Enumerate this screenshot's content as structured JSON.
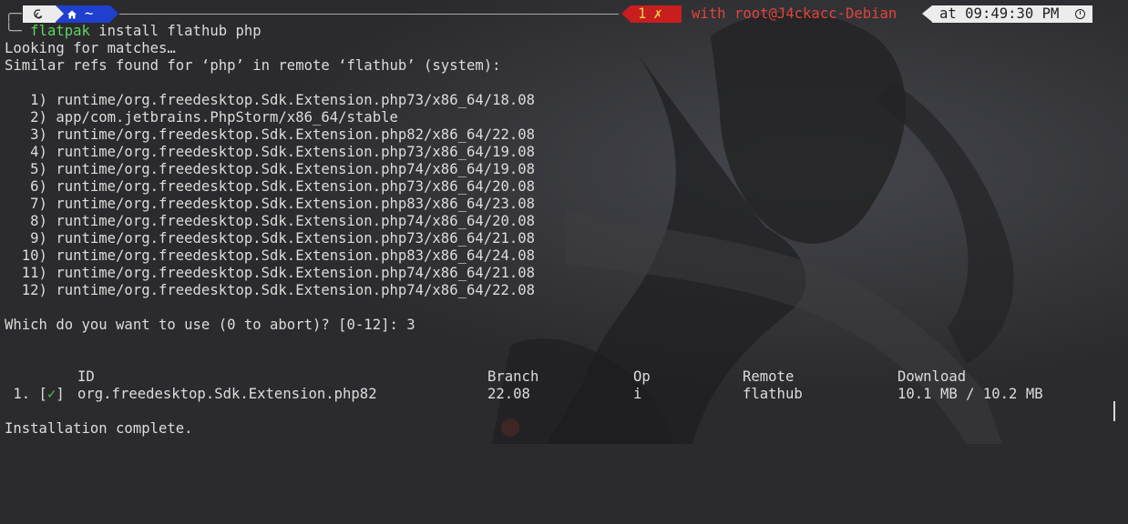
{
  "prompt": {
    "dir_icon": "home-icon",
    "dir_label": "~",
    "os_icon": "debian-swirl-icon",
    "error_count": "1",
    "error_mark": "✗",
    "user_host": "with root@J4ckacc-Debian",
    "time": "at 09:49:30 PM",
    "command_name": "flatpak",
    "command_args": " install flathub php"
  },
  "output": {
    "looking": "Looking for matches…",
    "similar": "Similar refs found for ‘php’ in remote ‘flathub’ (system):",
    "refs": [
      "   1) runtime/org.freedesktop.Sdk.Extension.php73/x86_64/18.08",
      "   2) app/com.jetbrains.PhpStorm/x86_64/stable",
      "   3) runtime/org.freedesktop.Sdk.Extension.php82/x86_64/22.08",
      "   4) runtime/org.freedesktop.Sdk.Extension.php73/x86_64/19.08",
      "   5) runtime/org.freedesktop.Sdk.Extension.php74/x86_64/19.08",
      "   6) runtime/org.freedesktop.Sdk.Extension.php73/x86_64/20.08",
      "   7) runtime/org.freedesktop.Sdk.Extension.php83/x86_64/23.08",
      "   8) runtime/org.freedesktop.Sdk.Extension.php74/x86_64/20.08",
      "   9) runtime/org.freedesktop.Sdk.Extension.php73/x86_64/21.08",
      "  10) runtime/org.freedesktop.Sdk.Extension.php83/x86_64/24.08",
      "  11) runtime/org.freedesktop.Sdk.Extension.php74/x86_64/21.08",
      "  12) runtime/org.freedesktop.Sdk.Extension.php74/x86_64/22.08"
    ],
    "question": "Which do you want to use (0 to abort)? [0-12]: 3",
    "table": {
      "headers": [
        "ID",
        "Branch",
        "Op",
        "Remote",
        "Download"
      ],
      "row": {
        "index": " 1. [",
        "check": "✓",
        "close": "]",
        "id": "org.freedesktop.Sdk.Extension.php82",
        "branch": "22.08",
        "op": "i",
        "remote": "flathub",
        "download": "10.1 MB / 10.2 MB"
      }
    },
    "complete": "Installation complete."
  },
  "colors": {
    "background": "#2b2b2e",
    "dir_segment": "#1f3fcf",
    "error_segment": "#c81e1e",
    "command": "#5fd35f",
    "user_host": "#e0443a"
  }
}
